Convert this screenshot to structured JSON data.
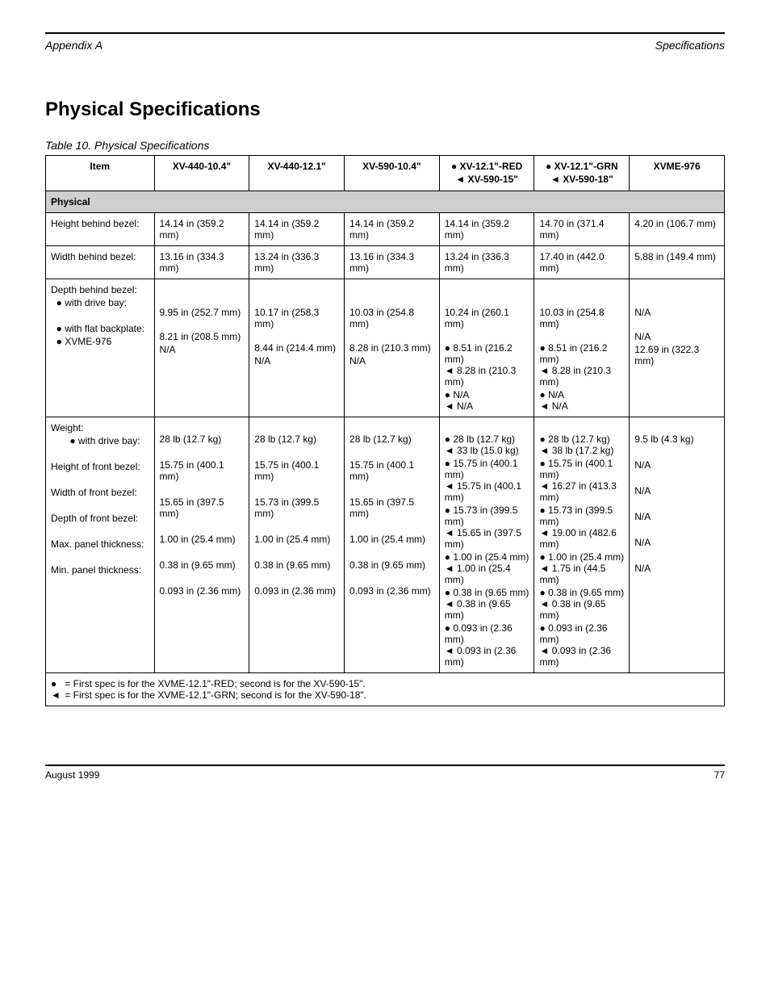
{
  "header": {
    "left": "Appendix A",
    "right": "Specifications"
  },
  "title": "Physical Specifications",
  "caption": "Table 10.  Physical Specifications",
  "columns": {
    "c0": "Item",
    "c1": "XV-440-10.4\"",
    "c2": "XV-440-12.1\"",
    "c3": "XV-590-10.4\"",
    "c4_l1": "XV-12.1\"-RED",
    "c4_l2": "XV-590-15\"",
    "c5_l1": "XV-12.1\"-GRN",
    "c5_l2": "XV-590-18\"",
    "c6": "XVME-976"
  },
  "group": "Physical",
  "rows": [
    {
      "item": "Height behind bezel:",
      "c1": "14.14 in (359.2 mm)",
      "c2": "14.14 in (359.2 mm)",
      "c3": "14.14 in (359.2 mm)",
      "c4": "14.14 in (359.2 mm)",
      "c5": "14.70 in (371.4 mm)",
      "c6": "4.20 in (106.7 mm)"
    },
    {
      "item": "Width behind bezel:",
      "c1": "13.16 in (334.3 mm)",
      "c2": "13.24 in (336.3 mm)",
      "c3": "13.16 in (334.3 mm)",
      "c4": "13.24 in (336.3 mm)",
      "c5": "17.40 in (442.0 mm)",
      "c6": "5.88 in (149.4 mm)"
    },
    {
      "item": "Depth behind bezel:",
      "bullets": [
        {
          "label": "with drive bay:",
          "c1": "9.95 in (252.7 mm)",
          "c2": "10.17 in (258.3 mm)",
          "c3": "10.03 in (254.8 mm)",
          "c4": "10.24 in (260.1 mm)",
          "c5": "10.03 in (254.8 mm)",
          "c6": "N/A"
        },
        {
          "label": "with flat backplate:",
          "c1": "8.21 in (208.5 mm)",
          "c2": "8.44 in (214.4 mm)",
          "c3": "8.28 in (210.3 mm)",
          "c4a": "8.51 in (216.2 mm)",
          "c4b": "8.28 in (210.3 mm)",
          "c5a": "8.51 in (216.2 mm)",
          "c5b": "8.28 in (210.3 mm)",
          "c6": "N/A"
        },
        {
          "label": "XVME-976",
          "c1": "N/A",
          "c2": "N/A",
          "c3": "N/A",
          "c4a": "N/A",
          "c4b": "N/A",
          "c5a": "N/A",
          "c5b": "N/A",
          "c6": "12.69 in (322.3 mm)"
        }
      ]
    },
    {
      "item": "Weight:",
      "sub": "with drive bay:",
      "c1": "28 lb (12.7 kg)",
      "c2": "28 lb (12.7 kg)",
      "c3": "28 lb (12.7 kg)",
      "c4a": "28 lb (12.7 kg)",
      "c4b": "33 lb (15.0 kg)",
      "c5a": "28 lb (12.7 kg)",
      "c5b": "38 lb (17.2 kg)",
      "c6": "9.5 lb (4.3 kg)"
    },
    {
      "item": "Height of front bezel:",
      "c1": "15.75 in (400.1 mm)",
      "c2": "15.75 in (400.1 mm)",
      "c3": "15.75 in (400.1 mm)",
      "c4a": "15.75 in (400.1 mm)",
      "c4b": "15.75 in (400.1 mm)",
      "c5a": "15.75 in (400.1 mm)",
      "c5b": "16.27 in (413.3 mm)",
      "c6": "N/A"
    },
    {
      "item": "Width of front bezel:",
      "c1": "15.65 in (397.5 mm)",
      "c2": "15.73 in (399.5 mm)",
      "c3": "15.65 in (397.5 mm)",
      "c4a": "15.73 in (399.5 mm)",
      "c4b": "15.65 in (397.5 mm)",
      "c5a": "15.73 in (399.5 mm)",
      "c5b": "19.00 in (482.6 mm)",
      "c6": "N/A"
    },
    {
      "item": "Depth of front bezel:",
      "c1": "1.00 in (25.4 mm)",
      "c2": "1.00 in (25.4 mm)",
      "c3": "1.00 in (25.4 mm)",
      "c4a": "1.00 in (25.4 mm)",
      "c4b": "1.00 in (25.4 mm)",
      "c5a": "1.00 in (25.4 mm)",
      "c5b": "1.75 in (44.5 mm)",
      "c6": "N/A"
    },
    {
      "item": "Max. panel thickness:",
      "c1": "0.38 in (9.65 mm)",
      "c2": "0.38 in (9.65 mm)",
      "c3": "0.38 in (9.65 mm)",
      "c4a": "0.38 in (9.65 mm)",
      "c4b": "0.38 in (9.65 mm)",
      "c5a": "0.38 in (9.65 mm)",
      "c5b": "0.38 in (9.65 mm)",
      "c6": "N/A"
    },
    {
      "item": "Min. panel thickness:",
      "c1": "0.093 in (2.36 mm)",
      "c2": "0.093 in (2.36 mm)",
      "c3": "0.093 in (2.36 mm)",
      "c4a": "0.093 in (2.36 mm)",
      "c4b": "0.093 in (2.36 mm)",
      "c5a": "0.093 in (2.36 mm)",
      "c5b": "0.093 in (2.36 mm)",
      "c6": "N/A"
    }
  ],
  "footnotes": [
    "= First spec is for the XVME-12.1\"-RED; second is for the XV-590-15\".",
    "= First spec is for the XVME-12.1\"-GRN; second is for the XV-590-18\"."
  ],
  "footer": {
    "left": "August 1999",
    "right": "77"
  }
}
